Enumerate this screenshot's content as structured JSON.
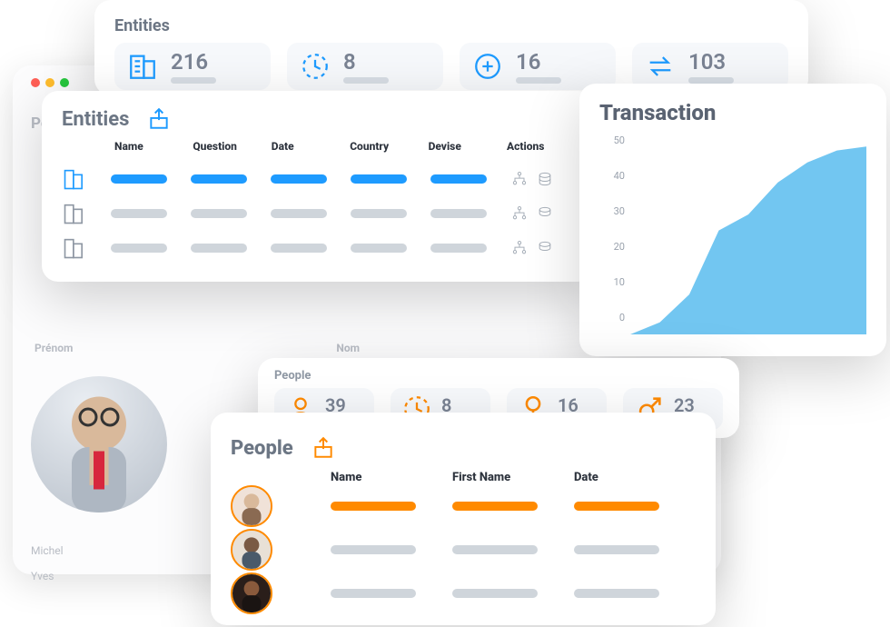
{
  "colors": {
    "blue": "#1e9bff",
    "orange": "#ff8a00",
    "grey": "#cfd5db"
  },
  "background_window": {
    "title": "Pe",
    "col_prenom": "Prénom",
    "col_nom": "Nom",
    "names": [
      "Michel",
      "Yves"
    ]
  },
  "entities_summary": {
    "title": "Entities",
    "stats": [
      {
        "icon": "building-icon",
        "value": "216"
      },
      {
        "icon": "clock-icon",
        "value": "8"
      },
      {
        "icon": "plus-circle-icon",
        "value": "16"
      },
      {
        "icon": "swap-icon",
        "value": "103"
      }
    ]
  },
  "entities_table": {
    "title": "Entities",
    "columns": [
      "Name",
      "Question",
      "Date",
      "Country",
      "Devise",
      "Actions"
    ]
  },
  "transaction": {
    "title": "Transaction"
  },
  "chart_data": {
    "type": "area",
    "title": "Transaction",
    "xlabel": "",
    "ylabel": "",
    "ylim": [
      0,
      50
    ],
    "yticks": [
      0,
      10,
      20,
      30,
      40,
      50
    ],
    "x": [
      0,
      1,
      2,
      3,
      4,
      5,
      6,
      7,
      8
    ],
    "values": [
      0,
      3,
      10,
      26,
      30,
      38,
      43,
      46,
      47
    ]
  },
  "people_summary": {
    "title": "People",
    "stats": [
      {
        "icon": "person-icon",
        "value": "39"
      },
      {
        "icon": "clock-icon",
        "value": "8"
      },
      {
        "icon": "female-icon",
        "value": "16"
      },
      {
        "icon": "male-icon",
        "value": "23"
      }
    ]
  },
  "people_table": {
    "title": "People",
    "columns": [
      "Name",
      "First Name",
      "Date"
    ]
  }
}
